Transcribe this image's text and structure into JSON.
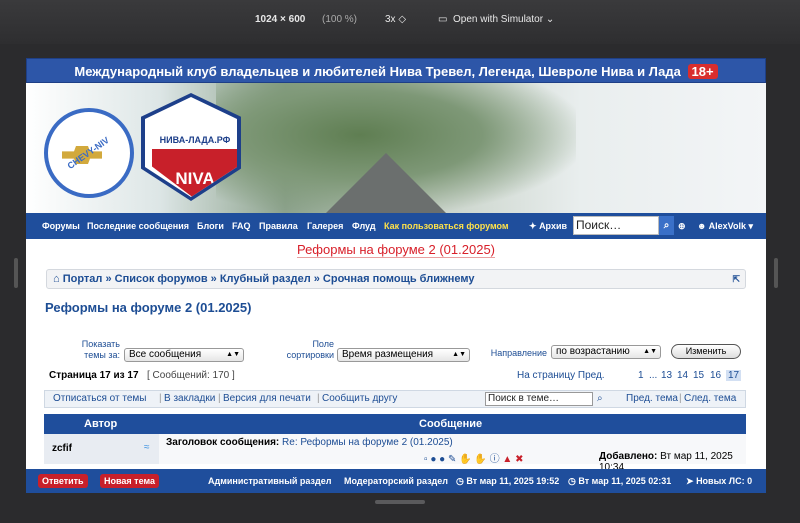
{
  "simulator": {
    "resolution": "1024 × 600",
    "zoom": "(100 %)",
    "scale": "3x ◇",
    "open_with": "Open with Simulator ⌄"
  },
  "site": {
    "top_title": "Международный клуб владельцев и любителей Нива Тревел, Легенда, Шевроле Нива и Лада",
    "age_badge": "18+",
    "logo_text": "НИВА-ЛАДА.РФ",
    "logo_brand": "NIVA",
    "chevy_text": "CHEVY-NIV"
  },
  "nav": {
    "items": [
      "Форумы",
      "Последние сообщения",
      "Блоги",
      "FAQ",
      "Правила",
      "Галерея",
      "Флуд"
    ],
    "highlight": "Как пользоваться форумом",
    "archive": "Архив",
    "search_placeholder": "Поиск…",
    "user": "AlexVolk"
  },
  "page": {
    "banner_title": "Реформы на форуме 2 (01.2025)",
    "breadcrumb": "Портал » Список форумов » Клубный раздел » Срочная помощь ближнему",
    "title": "Реформы на форуме 2 (01.2025)"
  },
  "filters": {
    "show_label": "Показать темы за:",
    "show_value": "Все сообщения",
    "sort_label": "Поле сортировки",
    "sort_value": "Время размещения",
    "dir_label": "Направление",
    "dir_value": "по возрастанию",
    "change_button": "Изменить"
  },
  "pagination": {
    "page_info": "Страница 17 из 17",
    "count": "[ Сообщений: 170 ]",
    "goto": "На страницу Пред.",
    "pages": [
      "1",
      "...",
      "13",
      "14",
      "15",
      "16"
    ],
    "current": "17"
  },
  "topic_toolbar": {
    "unsubscribe": "Отписаться от темы",
    "bookmark": "В закладки",
    "print": "Версия для печати",
    "tell": "Сообщить другу",
    "search_placeholder": "Поиск в теме…",
    "prev": "Пред. тема",
    "next": "След. тема"
  },
  "table": {
    "col_author": "Автор",
    "col_message": "Сообщение",
    "rows": [
      {
        "author": "zcfif",
        "subject_label": "Заголовок сообщения:",
        "subject": "Re: Реформы на форуме 2 (01.2025)",
        "added_label": "Добавлено:",
        "added": "Вт мар 11, 2025 10:34"
      }
    ]
  },
  "bottom_bar": {
    "reply": "Ответить",
    "new_topic": "Новая тема",
    "admin": "Административный раздел",
    "moderator": "Модераторский раздел",
    "time1": "Вт мар 11, 2025 19:52",
    "time2": "Вт мар 11, 2025 02:31",
    "pm": "Новых ЛС: 0"
  },
  "colors": {
    "brand_blue": "#1f4e9c",
    "link_blue": "#1d4d94",
    "accent_red": "#d8202a",
    "highlight": "#ffe24a"
  }
}
